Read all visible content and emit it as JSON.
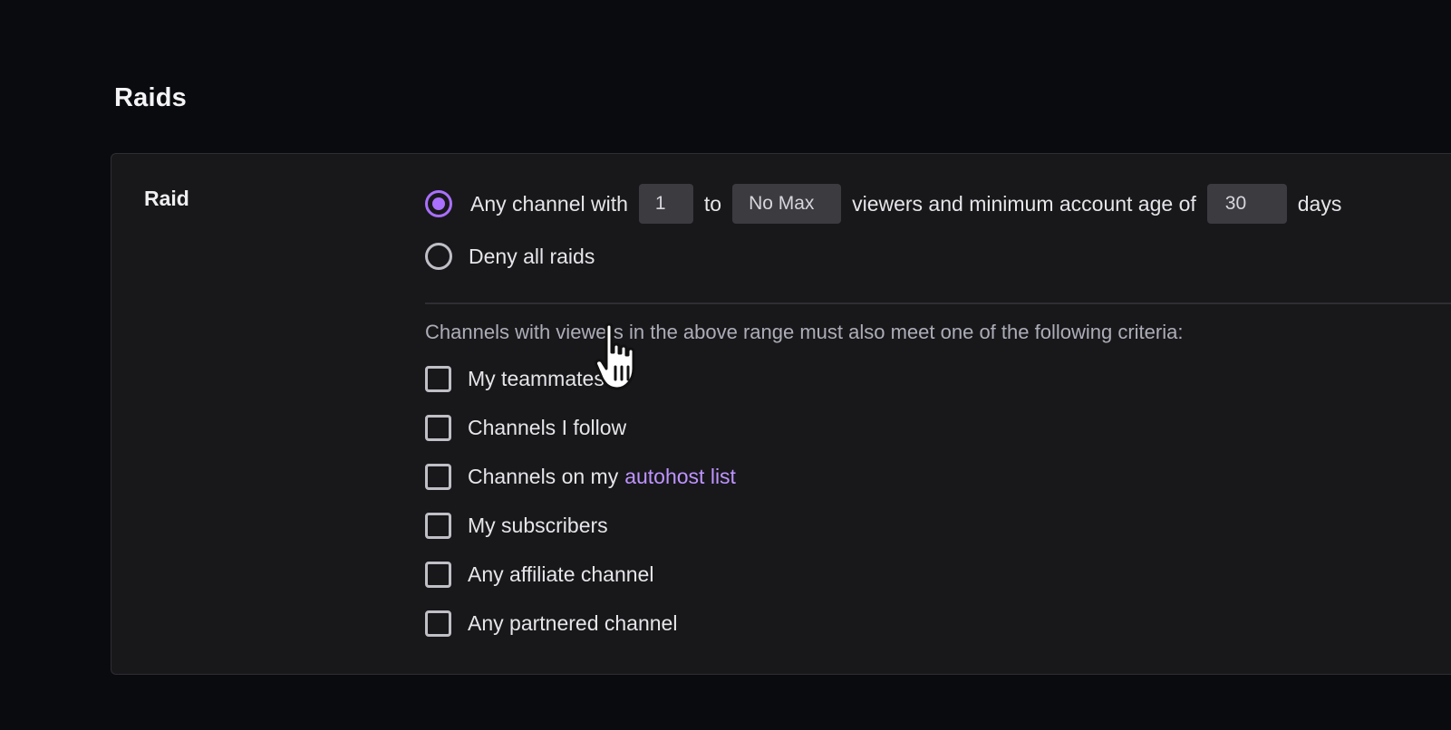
{
  "section": {
    "title": "Raids"
  },
  "raid": {
    "label": "Raid",
    "option_any": {
      "prefix": "Any channel with",
      "min_value": "1",
      "to_text": "to",
      "max_value": "No Max",
      "middle_text": "viewers and minimum account age of",
      "age_value": "30",
      "suffix": "days",
      "selected": true
    },
    "option_deny": {
      "label": "Deny all raids",
      "selected": false
    },
    "criteria_note": "Channels with viewers in the above range must also meet one of the following criteria:",
    "criteria": {
      "teammates": "My teammates",
      "follow": "Channels I follow",
      "autohost_prefix": "Channels on my",
      "autohost_link": "autohost list",
      "subscribers": "My subscribers",
      "affiliate": "Any affiliate channel",
      "partnered": "Any partnered channel"
    }
  },
  "colors": {
    "accent": "#a970ff",
    "link": "#bf94ff",
    "background": "#0a0b0e",
    "card": "#18181b"
  },
  "icons": {
    "cursor": "hand-pointer-icon"
  }
}
